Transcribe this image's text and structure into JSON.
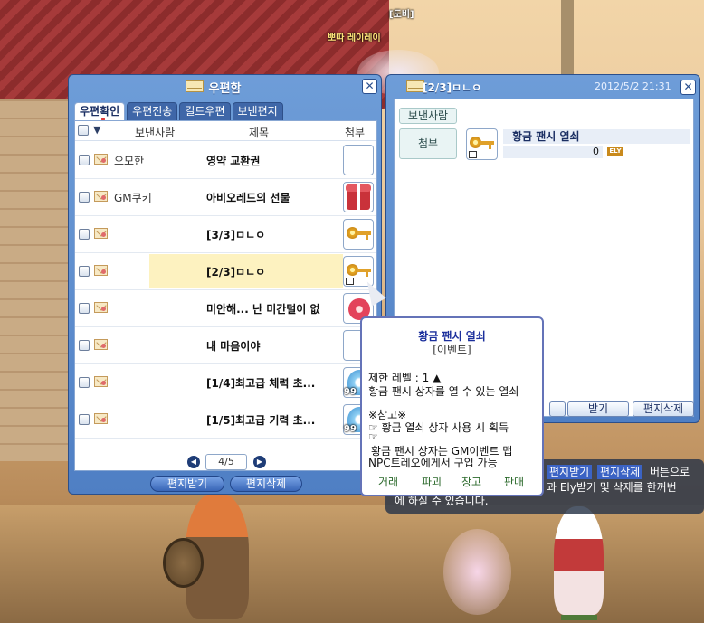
{
  "scene": {
    "npc_names": [
      "[도비]",
      "뽀따 레이레이"
    ],
    "npc_name_top": ""
  },
  "mailbox": {
    "title": "우편함",
    "tabs": [
      {
        "label": "우편확인",
        "active": true
      },
      {
        "label": "우편전송",
        "active": false
      },
      {
        "label": "길드우편",
        "active": false
      },
      {
        "label": "보낸편지",
        "active": false
      }
    ],
    "columns": {
      "sender": "보낸사람",
      "subject": "제목",
      "attach": "첨부"
    },
    "rows": [
      {
        "sender": "오모한",
        "subject": "영약 교환권",
        "attach": "empty",
        "qty": ""
      },
      {
        "sender": "GM쿠키",
        "subject": "아비오레드의 선물",
        "attach": "gift-icon",
        "qty": ""
      },
      {
        "sender": "",
        "subject": "[3/3]ㅁㄴㅇ",
        "attach": "key-icon",
        "qty": ""
      },
      {
        "sender": "",
        "subject": "[2/3]ㅁㄴㅇ",
        "attach": "key-icon",
        "qty": "",
        "selected": true
      },
      {
        "sender": "",
        "subject": "미안해... 난 미간털이 없",
        "attach": "flower-icon",
        "qty": ""
      },
      {
        "sender": "",
        "subject": "내 마음이야",
        "attach": "empty",
        "qty": ""
      },
      {
        "sender": "",
        "subject": "[1/4]최고급 체력 초...",
        "attach": "potion-icon",
        "qty": "99"
      },
      {
        "sender": "",
        "subject": "[1/5]최고급 기력 초...",
        "attach": "potion-icon",
        "qty": "99"
      }
    ],
    "pager": {
      "label": "4/5"
    },
    "buttons": {
      "receive": "편지받기",
      "delete": "편지삭제"
    }
  },
  "detail": {
    "title": "[2/3]ㅁㄴㅇ",
    "date": "2012/5/2 21:31",
    "sender_label": "보낸사람",
    "attach_label": "첨부",
    "item_name": "황금 팬시 열쇠",
    "ely_amount": "0",
    "ely_badge": "ELY",
    "buttons": {
      "reply": "",
      "receive": "받기",
      "delete": "편지삭제"
    }
  },
  "hint": {
    "highlight_1": "편지받기",
    "highlight_2": "편지삭제",
    "line1": "버튼으로",
    "line2": "과 Ely받기 및 삭제를 한꺼번",
    "line3": "에 하실 수 있습니다."
  },
  "tooltip": {
    "title": "황금 팬시 열쇠",
    "category": "[이벤트]",
    "level": "제한 레벨 : 1 ▲",
    "desc": "황금 팬시 상자를 열 수 있는 열쇠",
    "note": "※참고※",
    "tip1": "☞ 황금 열쇠 상자 사용 시 획득",
    "tip2": "☞",
    "tip3": "황금 팬시 상자는 GM이벤트 맵",
    "tip4": "NPC트레오에게서 구입 가능",
    "actions": [
      "거래",
      "파괴",
      "창고",
      "판매"
    ]
  },
  "colors": {
    "window_blue": "#5b8ad0",
    "tooltip_border": "#6473b8",
    "selected_row": "#fdf2c0",
    "hint_bg": "#283448"
  }
}
